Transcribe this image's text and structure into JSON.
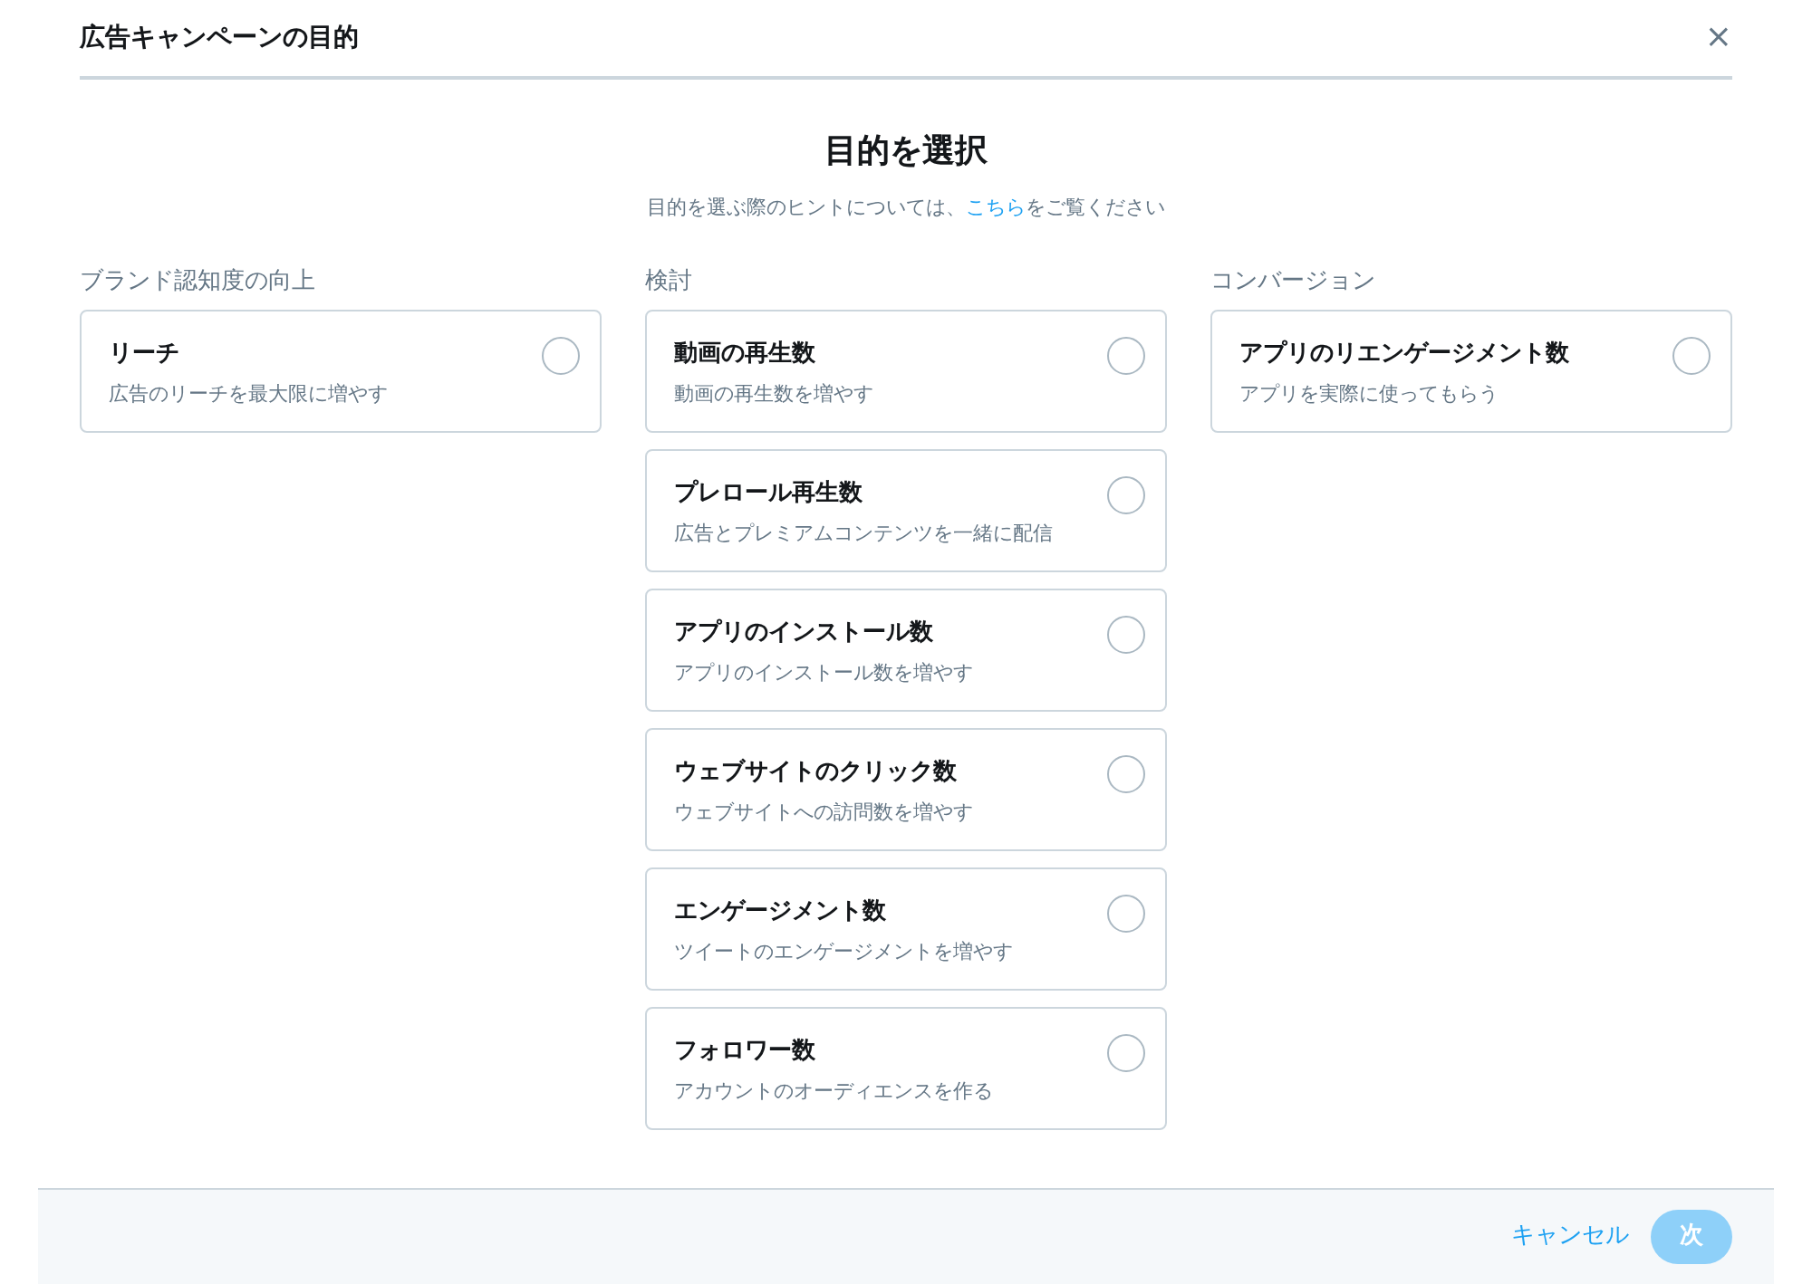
{
  "dialog": {
    "title": "広告キャンペーンの目的",
    "close": "×"
  },
  "heading": "目的を選択",
  "hint": {
    "before": "目的を選ぶ際のヒントについては、",
    "link": "こちら",
    "after": "をご覧ください"
  },
  "columns": [
    {
      "title": "ブランド認知度の向上",
      "options": [
        {
          "title": "リーチ",
          "description": "広告のリーチを最大限に増やす",
          "selected": false
        }
      ]
    },
    {
      "title": "検討",
      "options": [
        {
          "title": "動画の再生数",
          "description": "動画の再生数を増やす",
          "selected": false
        },
        {
          "title": "プレロール再生数",
          "description": "広告とプレミアムコンテンツを一緒に配信",
          "selected": false
        },
        {
          "title": "アプリのインストール数",
          "description": "アプリのインストール数を増やす",
          "selected": false
        },
        {
          "title": "ウェブサイトのクリック数",
          "description": "ウェブサイトへの訪問数を増やす",
          "selected": false
        },
        {
          "title": "エンゲージメント数",
          "description": "ツイートのエンゲージメントを増やす",
          "selected": false
        },
        {
          "title": "フォロワー数",
          "description": "アカウントのオーディエンスを作る",
          "selected": false
        }
      ]
    },
    {
      "title": "コンバージョン",
      "options": [
        {
          "title": "アプリのリエンゲージメント数",
          "description": "アプリを実際に使ってもらう",
          "selected": false
        }
      ]
    }
  ],
  "footer": {
    "cancel": "キャンセル",
    "next": {
      "label": "次",
      "disabled": true
    }
  }
}
